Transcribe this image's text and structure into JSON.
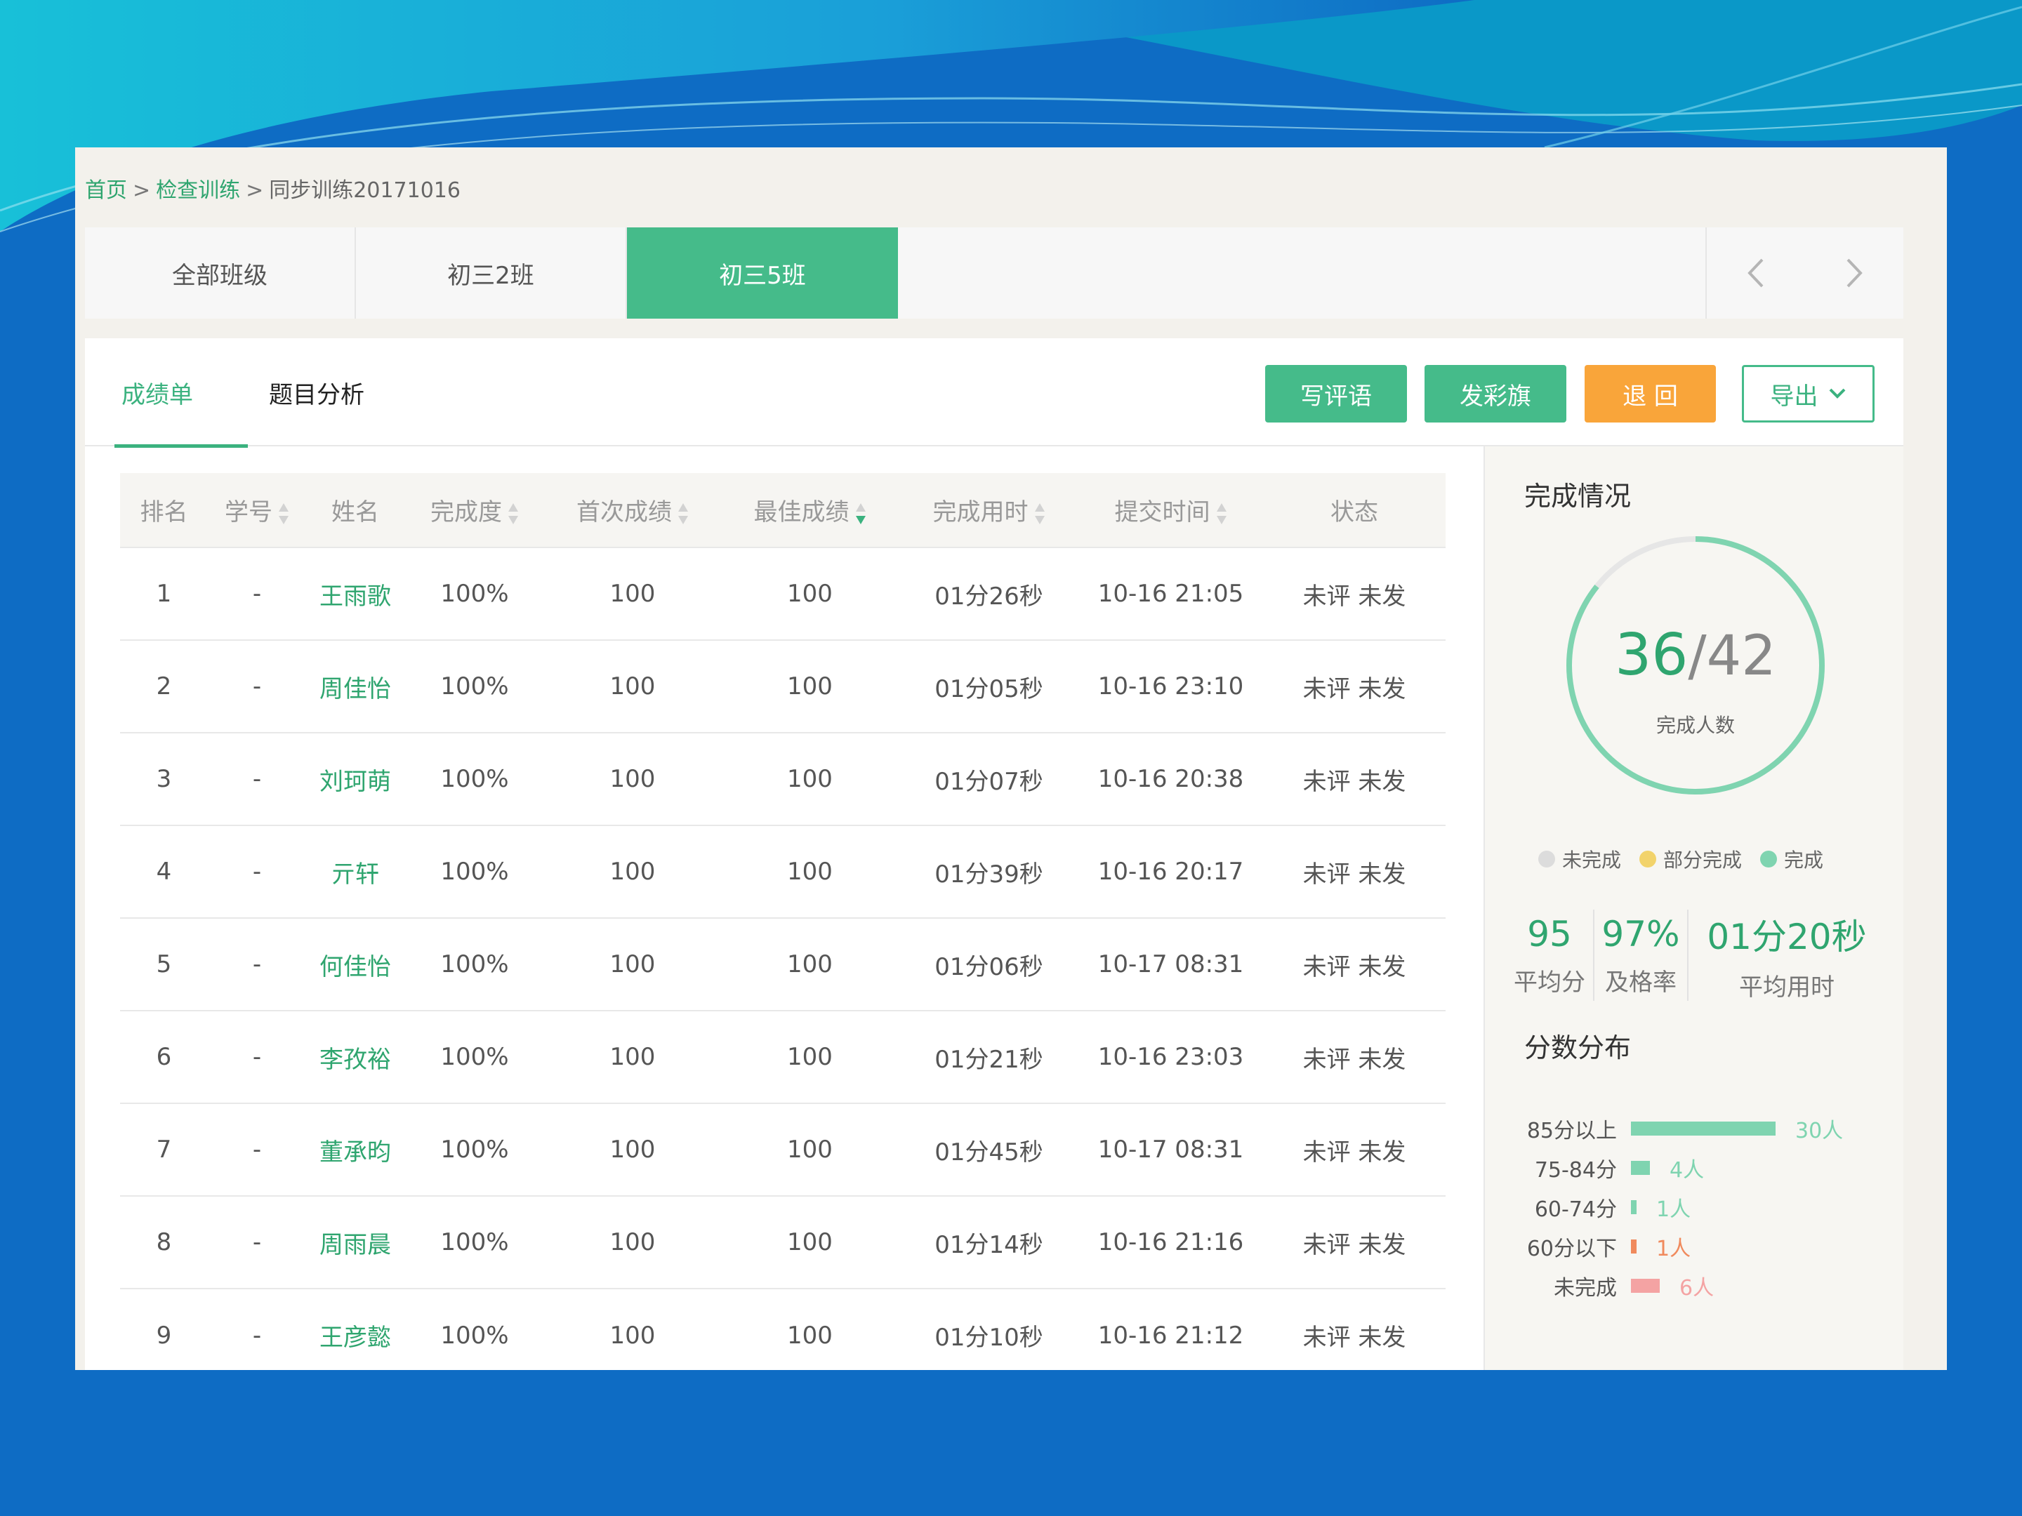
{
  "breadcrumb": {
    "home": "首页",
    "sep": ">",
    "check": "检查训练",
    "current": "同步训练20171016"
  },
  "class_tabs": [
    "全部班级",
    "初三2班",
    "初三5班"
  ],
  "sub_tabs": {
    "scores": "成绩单",
    "analysis": "题目分析"
  },
  "buttons": {
    "comment": "写评语",
    "flag": "发彩旗",
    "return": "退 回",
    "export": "导出"
  },
  "table": {
    "headers": [
      "排名",
      "学号",
      "姓名",
      "完成度",
      "首次成绩",
      "最佳成绩",
      "完成用时",
      "提交时间",
      "状态"
    ],
    "rows": [
      {
        "rank": "1",
        "id": "-",
        "name": "王雨歌",
        "completion": "100%",
        "first": "100",
        "best": "100",
        "time": "01分26秒",
        "submit": "10-16 21:05",
        "status": "未评 未发"
      },
      {
        "rank": "2",
        "id": "-",
        "name": "周佳怡",
        "completion": "100%",
        "first": "100",
        "best": "100",
        "time": "01分05秒",
        "submit": "10-16 23:10",
        "status": "未评 未发"
      },
      {
        "rank": "3",
        "id": "-",
        "name": "刘珂萌",
        "completion": "100%",
        "first": "100",
        "best": "100",
        "time": "01分07秒",
        "submit": "10-16 20:38",
        "status": "未评 未发"
      },
      {
        "rank": "4",
        "id": "-",
        "name": "亓轩",
        "completion": "100%",
        "first": "100",
        "best": "100",
        "time": "01分39秒",
        "submit": "10-16 20:17",
        "status": "未评 未发"
      },
      {
        "rank": "5",
        "id": "-",
        "name": "何佳怡",
        "completion": "100%",
        "first": "100",
        "best": "100",
        "time": "01分06秒",
        "submit": "10-17 08:31",
        "status": "未评 未发"
      },
      {
        "rank": "6",
        "id": "-",
        "name": "李孜裕",
        "completion": "100%",
        "first": "100",
        "best": "100",
        "time": "01分21秒",
        "submit": "10-16 23:03",
        "status": "未评 未发"
      },
      {
        "rank": "7",
        "id": "-",
        "name": "董承昀",
        "completion": "100%",
        "first": "100",
        "best": "100",
        "time": "01分45秒",
        "submit": "10-17 08:31",
        "status": "未评 未发"
      },
      {
        "rank": "8",
        "id": "-",
        "name": "周雨晨",
        "completion": "100%",
        "first": "100",
        "best": "100",
        "time": "01分14秒",
        "submit": "10-16 21:16",
        "status": "未评 未发"
      },
      {
        "rank": "9",
        "id": "-",
        "name": "王彦懿",
        "completion": "100%",
        "first": "100",
        "best": "100",
        "time": "01分10秒",
        "submit": "10-16 21:12",
        "status": "未评 未发"
      }
    ]
  },
  "completion": {
    "title": "完成情况",
    "done": "36",
    "total": "/42",
    "done_count": 36,
    "total_count": 42,
    "label": "完成人数",
    "legend": [
      {
        "label": "未完成",
        "color": "#dcdcdc"
      },
      {
        "label": "部分完成",
        "color": "#f2d36b"
      },
      {
        "label": "完成",
        "color": "#7fd4b0"
      }
    ]
  },
  "stats": [
    {
      "value": "95",
      "label": "平均分"
    },
    {
      "value": "97%",
      "label": "及格率"
    },
    {
      "value": "01分20秒",
      "label": "平均用时"
    }
  ],
  "distribution": {
    "title": "分数分布",
    "rows": [
      {
        "label": "85分以上",
        "count": 30,
        "text": "30人",
        "color": "#7fd4b0"
      },
      {
        "label": "75-84分",
        "count": 4,
        "text": "4人",
        "color": "#7fd4b0"
      },
      {
        "label": "60-74分",
        "count": 1,
        "text": "1人",
        "color": "#7fd4b0"
      },
      {
        "label": "60分以下",
        "count": 1,
        "text": "1人",
        "color": "#f08a5d"
      },
      {
        "label": "未完成",
        "count": 6,
        "text": "6人",
        "color": "#f4a3a3"
      }
    ]
  },
  "colors": {
    "accent": "#45bb8a",
    "orange": "#f9a53a",
    "background": "#0e6cc4"
  }
}
